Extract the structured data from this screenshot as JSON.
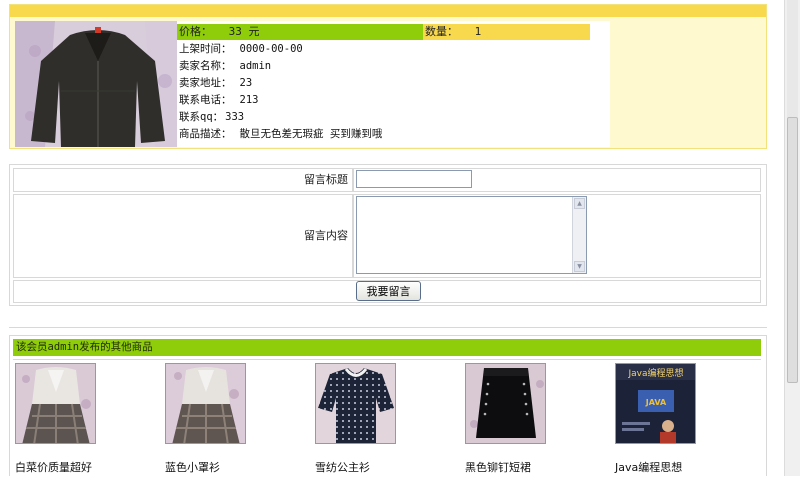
{
  "product": {
    "price_label": "价格：",
    "price_value": "33 元",
    "quantity_label": "数量：",
    "quantity_value": "1",
    "fields": [
      {
        "label": "上架时间：",
        "value": "0000-00-00"
      },
      {
        "label": "卖家名称：",
        "value": "admin"
      },
      {
        "label": "卖家地址：",
        "value": "23"
      },
      {
        "label": "联系电话：",
        "value": "213"
      },
      {
        "label": "联系qq：",
        "value": "333"
      },
      {
        "label": "商品描述：",
        "value": "散旦无色差无瑕疵 买到赚到哦"
      }
    ]
  },
  "form": {
    "title_label": "留言标题",
    "title_value": "",
    "content_label": "留言内容",
    "content_value": "",
    "submit_label": "我要留言"
  },
  "others": {
    "header": "该会员admin发布的其他商品",
    "items": [
      {
        "name": "白菜价质量超好",
        "icon": "vest-skirt-photo"
      },
      {
        "name": "蓝色小罩衫",
        "icon": "vest-skirt-photo"
      },
      {
        "name": "雪纺公主衫",
        "icon": "polka-blouse-photo"
      },
      {
        "name": "黑色铆钉短裙",
        "icon": "black-skirt-photo"
      },
      {
        "name": "Java编程思想",
        "icon": "book-cover-photo",
        "cover_title": "Java编程思想",
        "cover_logo": "JAVA"
      }
    ]
  },
  "colors": {
    "accent_green": "#8fcc0a",
    "accent_yellow": "#f8d94e",
    "panel_bg": "#fef9ce"
  }
}
